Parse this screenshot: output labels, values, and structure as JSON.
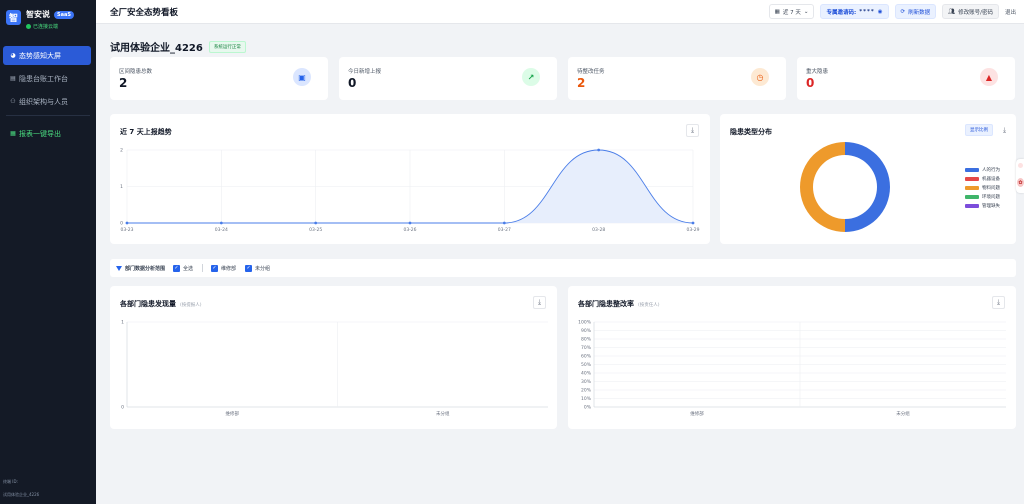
{
  "sidebar": {
    "brand_logo": "智",
    "brand_name": "智安说",
    "brand_badge": "SaaS",
    "brand_status": "已连接云端",
    "items": [
      {
        "label": "态势感知大屏",
        "icon": "dashboard-icon",
        "active": true
      },
      {
        "label": "隐患台账工作台",
        "icon": "document-icon",
        "active": false
      },
      {
        "label": "组织架构与人员",
        "icon": "users-icon",
        "active": false
      }
    ],
    "export_label": "报表一键导出",
    "footer_label": "终端 ID:",
    "footer_account": "试用体验企业_4226"
  },
  "header": {
    "title": "全厂安全态势看板",
    "range_label": "近 7 天",
    "pass_label": "专属邀请码:",
    "pass_value": "****",
    "refresh_label": "刷新数据",
    "account_label": "修改账号/密码",
    "logout_label": "退出"
  },
  "company": {
    "name": "试用体验企业_4226",
    "status": "系统运行正常"
  },
  "stats": [
    {
      "label": "区间隐患总数",
      "value": "2",
      "color": "#111827",
      "icon": "clipboard-icon",
      "icon_bg": "#dbe6ff",
      "icon_color": "#2563eb"
    },
    {
      "label": "今日新增上报",
      "value": "0",
      "color": "#111827",
      "icon": "trend-up-icon",
      "icon_bg": "#dcfce7",
      "icon_color": "#16a34a"
    },
    {
      "label": "待整改任务",
      "value": "2",
      "color": "#ea580c",
      "icon": "clock-icon",
      "icon_bg": "#fde9d3",
      "icon_color": "#ea580c"
    },
    {
      "label": "重大隐患",
      "value": "0",
      "color": "#dc2626",
      "icon": "warning-icon",
      "icon_bg": "#fde2e2",
      "icon_color": "#dc2626"
    }
  ],
  "trend": {
    "title": "近 7 天上报趋势"
  },
  "pie": {
    "title": "隐患类型分布",
    "toggle_label": "显示比例"
  },
  "filter": {
    "label": "部门数据分析范围",
    "options": [
      "全选",
      "维修部",
      "未分组"
    ]
  },
  "dept_count": {
    "title": "各部门隐患发现量",
    "subtitle": "(按提报人)"
  },
  "dept_rate": {
    "title": "各部门隐患整改率",
    "subtitle": "(按责任人)"
  },
  "chart_data": [
    {
      "type": "area",
      "title": "近 7 天上报趋势",
      "x": [
        "03-23",
        "03-24",
        "03-25",
        "03-26",
        "03-27",
        "03-28",
        "03-29"
      ],
      "values": [
        0,
        0,
        0,
        0,
        0,
        2,
        0
      ],
      "ylim": [
        0,
        2
      ],
      "yticks": [
        0,
        1,
        2
      ],
      "grid": true,
      "color": "#4a7de8"
    },
    {
      "type": "pie",
      "title": "隐患类型分布",
      "donut": true,
      "slices": [
        {
          "label": "人的行为",
          "value": 1,
          "color": "#3b6fe0"
        },
        {
          "label": "机器设备",
          "value": 0,
          "color": "#e54848"
        },
        {
          "label": "物料问题",
          "value": 1,
          "color": "#ee9a2b"
        },
        {
          "label": "环境问题",
          "value": 0,
          "color": "#3fb56a"
        },
        {
          "label": "管理缺失",
          "value": 0,
          "color": "#7c4ddb"
        }
      ],
      "legend": "right"
    },
    {
      "type": "bar",
      "title": "各部门隐患发现量",
      "categories": [
        "维修部",
        "未分组"
      ],
      "values": [
        0,
        0
      ],
      "ylim": [
        0,
        1
      ],
      "yticks": [
        0,
        1
      ],
      "grid": true
    },
    {
      "type": "bar",
      "title": "各部门隐患整改率",
      "categories": [
        "维修部",
        "未分组"
      ],
      "values": [
        0,
        0
      ],
      "ylim": [
        0,
        100
      ],
      "yticks": [
        "0%",
        "10%",
        "20%",
        "30%",
        "40%",
        "50%",
        "60%",
        "70%",
        "80%",
        "90%",
        "100%"
      ],
      "grid": true
    }
  ]
}
